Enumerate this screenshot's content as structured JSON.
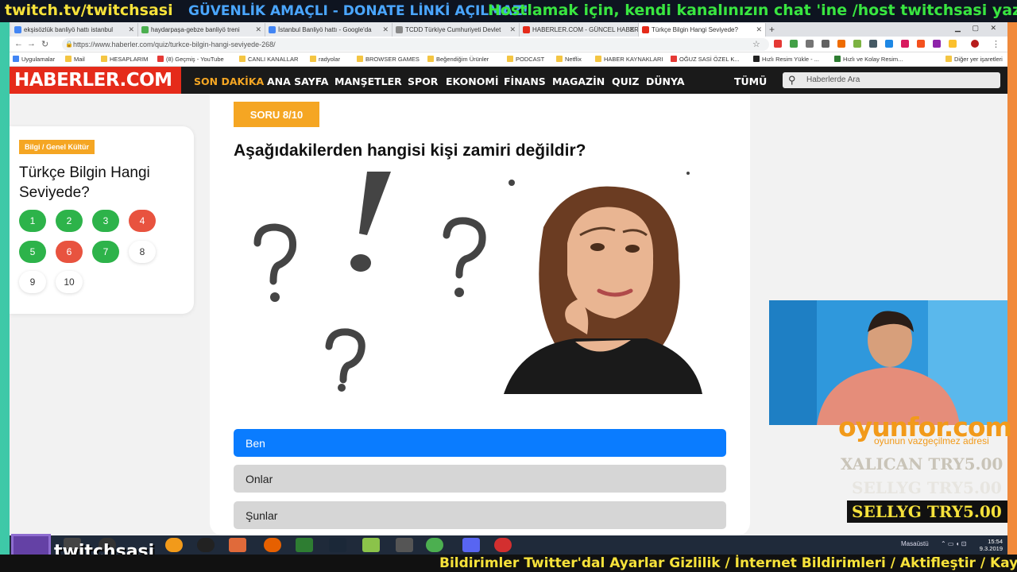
{
  "overlay": {
    "top_banner": [
      "twitch.tv/twitchsasi",
      "GÜVENLİK AMAÇLI - DONATE LİNKİ AÇILMAZ!",
      "Hostlamak için, kendi kanalınızın chat 'ine /host twitchsasi yazın"
    ],
    "bottom_ticker": "Bildirimler Twitter'dal Ayarlar Gizlilik / İnternet Bildirimleri / Aktifleştir / Kayda",
    "twitch_name": "twitchsasi",
    "sponsor_name": "oyunfor.com",
    "sponsor_tagline": "oyunun vazgeçilmez adresi",
    "donors": [
      "XALICAN TRY5.00",
      "SELLYG TRY5.00",
      "SELLYG TRY5.00"
    ]
  },
  "browser": {
    "tabs": [
      {
        "label": "ekşisözlük banliyö hattı istanbul",
        "color": "#4285f4"
      },
      {
        "label": "haydarpaşa-gebze banliyö treni",
        "color": "#4caf50"
      },
      {
        "label": "İstanbul Banliyö hattı - Google'da",
        "color": "#4285f4"
      },
      {
        "label": "TCDD Türkiye Cumhuriyeti Devlet",
        "color": "#888"
      },
      {
        "label": "HABERLER.COM - GÜNCEL HABER",
        "color": "#e52b1a"
      },
      {
        "label": "Türkçe Bilgin Hangi Seviyede?",
        "color": "#e52b1a"
      }
    ],
    "url": "https://www.haberler.com/quiz/turkce-bilgin-hangi-seviyede-268/",
    "bookmarks": [
      "Uygulamalar",
      "Mail",
      "HESAPLARIM",
      "(8) Geçmiş - YouTube",
      "CANLI KANALLAR",
      "radyolar",
      "BROWSER GAMES",
      "Beğendiğim Ürünler",
      "PODCAST",
      "Netflix",
      "HABER KAYNAKLARI",
      "OĞUZ SASİ ÖZEL K...",
      "Hızlı Resim Yükle - ...",
      "Hızlı ve Kolay Resim...",
      "Diğer yer işaretleri"
    ]
  },
  "site": {
    "logo": "HABERLER.COM",
    "nav": [
      "SON DAKİKA",
      "ANA SAYFA",
      "MANŞETLER",
      "SPOR",
      "EKONOMİ",
      "FİNANS",
      "MAGAZİN",
      "QUIZ",
      "DÜNYA"
    ],
    "nav_all": "TÜMÜ",
    "search_placeholder": "Haberlerde Ara"
  },
  "sidebar": {
    "category": "Bilgi / Genel Kültür",
    "title": "Türkçe Bilgin Hangi Seviyede?",
    "questions": [
      {
        "n": "1",
        "state": "green"
      },
      {
        "n": "2",
        "state": "green"
      },
      {
        "n": "3",
        "state": "green"
      },
      {
        "n": "4",
        "state": "red"
      },
      {
        "n": "5",
        "state": "green"
      },
      {
        "n": "6",
        "state": "red"
      },
      {
        "n": "7",
        "state": "green"
      },
      {
        "n": "8",
        "state": "white"
      },
      {
        "n": "9",
        "state": "white"
      },
      {
        "n": "10",
        "state": "white"
      }
    ]
  },
  "quiz": {
    "counter": "SORU 8/10",
    "question": "Aşağıdakilerden hangisi kişi zamiri değildir?",
    "answers": [
      "Ben",
      "Onlar",
      "Şunlar"
    ],
    "selected_index": 0
  },
  "taskbar": {
    "desktop_label": "Masaüstü",
    "time": "15:54",
    "date": "9.3.2019"
  },
  "colors": {
    "brand_red": "#e52b1a",
    "accent_orange": "#f5a623",
    "answer_selected": "#0a7cff"
  }
}
